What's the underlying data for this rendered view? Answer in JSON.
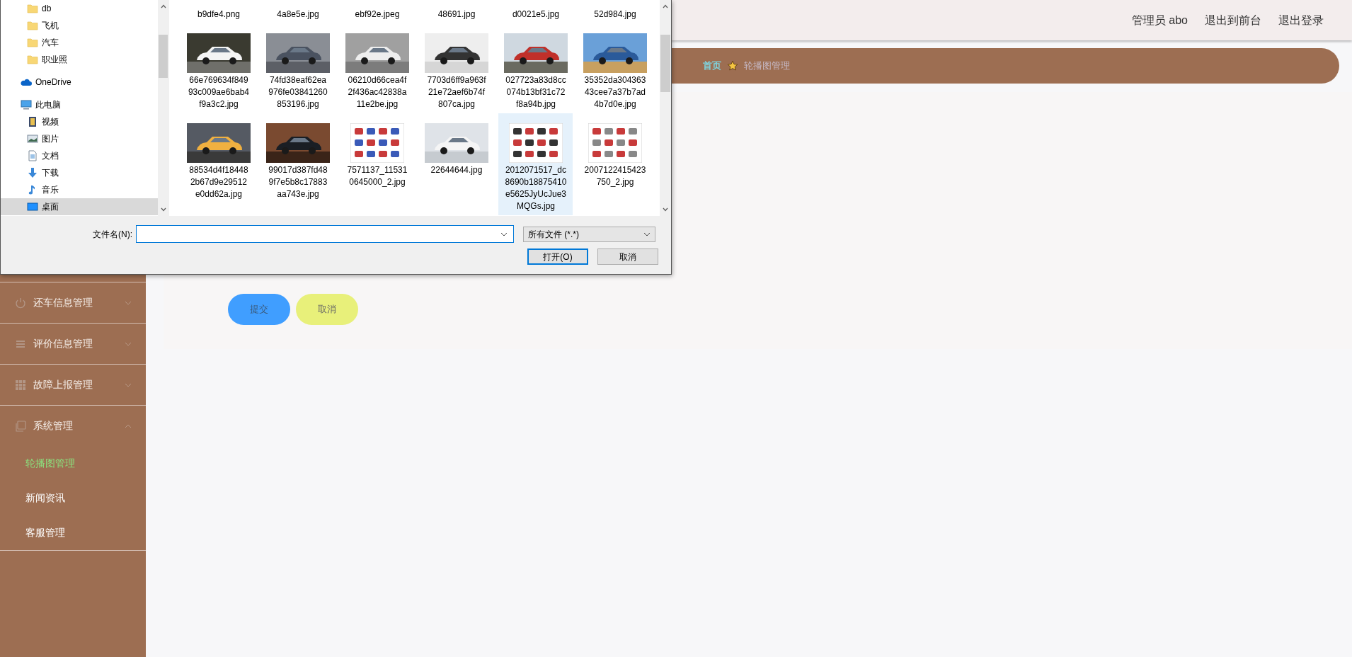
{
  "header": {
    "links": [
      "管理员 abo",
      "退出到前台",
      "退出登录"
    ]
  },
  "breadcrumb": [
    {
      "label": "首页",
      "current": false
    },
    {
      "label": "轮播图管理",
      "current": true
    }
  ],
  "sidebar": {
    "menus": [
      {
        "label": "还车信息管理",
        "kind": "power",
        "expanded": false
      },
      {
        "label": "评价信息管理",
        "kind": "list",
        "expanded": false
      },
      {
        "label": "故障上报管理",
        "kind": "grid",
        "expanded": false
      },
      {
        "label": "系统管理",
        "kind": "copy",
        "expanded": true,
        "children": [
          {
            "label": "轮播图管理",
            "selected": true
          },
          {
            "label": "新闻资讯",
            "selected": false
          },
          {
            "label": "客服管理",
            "selected": false
          }
        ]
      }
    ]
  },
  "form_buttons": [
    {
      "label": "提交",
      "kind": "primary"
    },
    {
      "label": "取消",
      "kind": "cancel"
    }
  ],
  "file_dialog": {
    "nav_tree": [
      {
        "children": [
          {
            "label": "db",
            "kind": "folder",
            "selected": false
          },
          {
            "label": "飞机",
            "kind": "folder",
            "selected": false
          },
          {
            "label": "汽车",
            "kind": "folder",
            "selected": false
          },
          {
            "label": "职业照",
            "kind": "folder",
            "selected": false
          }
        ]
      },
      {
        "label": "OneDrive",
        "kind": "cloud",
        "selected": false
      },
      {
        "label": "此电脑",
        "kind": "computer",
        "selected": false,
        "children": [
          {
            "label": "视频",
            "kind": "video",
            "selected": false
          },
          {
            "label": "图片",
            "kind": "pictures",
            "selected": false
          },
          {
            "label": "文档",
            "kind": "document",
            "selected": false
          },
          {
            "label": "下载",
            "kind": "download",
            "selected": false
          },
          {
            "label": "音乐",
            "kind": "music",
            "selected": false
          },
          {
            "label": "桌面",
            "kind": "desktop",
            "selected": true
          }
        ]
      }
    ],
    "files": [
      {
        "kind": "name_only",
        "name_lines": [
          "b9dfe4.png"
        ],
        "selected": false
      },
      {
        "kind": "name_only",
        "name_lines": [
          "4a8e5e.jpg"
        ],
        "selected": false
      },
      {
        "kind": "name_only",
        "name_lines": [
          "ebf92e.jpeg"
        ],
        "selected": false
      },
      {
        "kind": "name_only",
        "name_lines": [
          "48691.jpg"
        ],
        "selected": false
      },
      {
        "kind": "name_only",
        "name_lines": [
          "d0021e5.jpg"
        ],
        "selected": false
      },
      {
        "kind": "name_only",
        "name_lines": [
          "52d984.jpg"
        ],
        "selected": false
      },
      {
        "kind": "thumbnail",
        "name_lines": [
          "66e769634f849",
          "93c009ae6bab4",
          "f9a3c2.jpg"
        ],
        "selected": false
      },
      {
        "kind": "thumbnail",
        "name_lines": [
          "74fd38eaf62ea",
          "976fe03841260",
          "853196.jpg"
        ],
        "selected": false
      },
      {
        "kind": "thumbnail",
        "name_lines": [
          "06210d66cea4f",
          "2f436ac42838a",
          "11e2be.jpg"
        ],
        "selected": false
      },
      {
        "kind": "thumbnail",
        "name_lines": [
          "7703d6ff9a963f",
          "21e72aef6b74f",
          "807ca.jpg"
        ],
        "selected": false
      },
      {
        "kind": "thumbnail",
        "name_lines": [
          "027723a83d8cc",
          "074b13bf31c72",
          "f8a94b.jpg"
        ],
        "selected": false
      },
      {
        "kind": "thumbnail",
        "name_lines": [
          "35352da304363",
          "43cee7a37b7ad",
          "4b7d0e.jpg"
        ],
        "selected": false
      },
      {
        "kind": "thumbnail",
        "name_lines": [
          "88534d4f18448",
          "2b67d9e29512",
          "e0dd62a.jpg"
        ],
        "selected": false
      },
      {
        "kind": "thumbnail",
        "name_lines": [
          "99017d387fd48",
          "9f7e5b8c17883",
          "aa743e.jpg"
        ],
        "selected": false
      },
      {
        "kind": "thumbnail",
        "name_lines": [
          "7571137_11531",
          "0645000_2.jpg"
        ],
        "selected": false
      },
      {
        "kind": "thumbnail",
        "name_lines": [
          "22644644.jpg"
        ],
        "selected": false
      },
      {
        "kind": "thumbnail",
        "name_lines": [
          "2012071517_dc",
          "8690b18875410",
          "e5625JyUcJue3",
          "MQGs.jpg"
        ],
        "selected": true
      },
      {
        "kind": "thumbnail",
        "name_lines": [
          "2007122415423",
          "750_2.jpg"
        ],
        "selected": false
      }
    ],
    "file_name_label": "文件名(N):",
    "file_type": "所有文件 (*.*)",
    "buttons": [
      {
        "label": "打开(O)",
        "default": true
      },
      {
        "label": "取消",
        "default": false
      }
    ]
  }
}
